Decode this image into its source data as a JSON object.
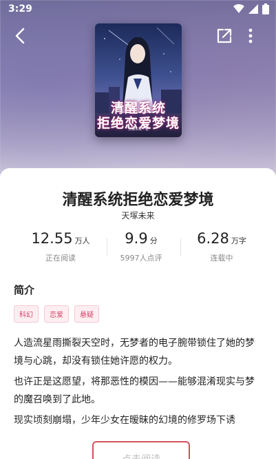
{
  "status_bar": {
    "time": "3:29"
  },
  "book": {
    "cover_title_line1": "清醒系统",
    "cover_title_line2": "拒绝恋爱梦境",
    "cover_author": "天塚未来 · 著",
    "title": "清醒系统拒绝恋爱梦境",
    "author": "天塚未来"
  },
  "stats": [
    {
      "value": "12.55",
      "unit": "万人",
      "label": "正在阅读"
    },
    {
      "value": "9.9",
      "unit": "分",
      "label": "5997人点评"
    },
    {
      "value": "6.28",
      "unit": "万字",
      "label": "连载中"
    }
  ],
  "intro": {
    "heading": "简介",
    "tags": [
      "科幻",
      "恋爱",
      "悬疑"
    ],
    "paragraphs": [
      "人造流星雨撕裂天空时，无梦者的电子腕带锁住了她的梦境与心跳，却没有锁住她许愿的权力。",
      "也许正是这愿望，将那恶性的模因——能够混淆现实与梦的魔召唤到了此地。",
      "现实顷刻崩塌，少年少女在暧昧的幻境的修罗场下诱"
    ]
  },
  "actions": {
    "read_label": "点击阅读"
  },
  "colors": {
    "accent": "#d4456d",
    "button_border": "#d4505a"
  }
}
